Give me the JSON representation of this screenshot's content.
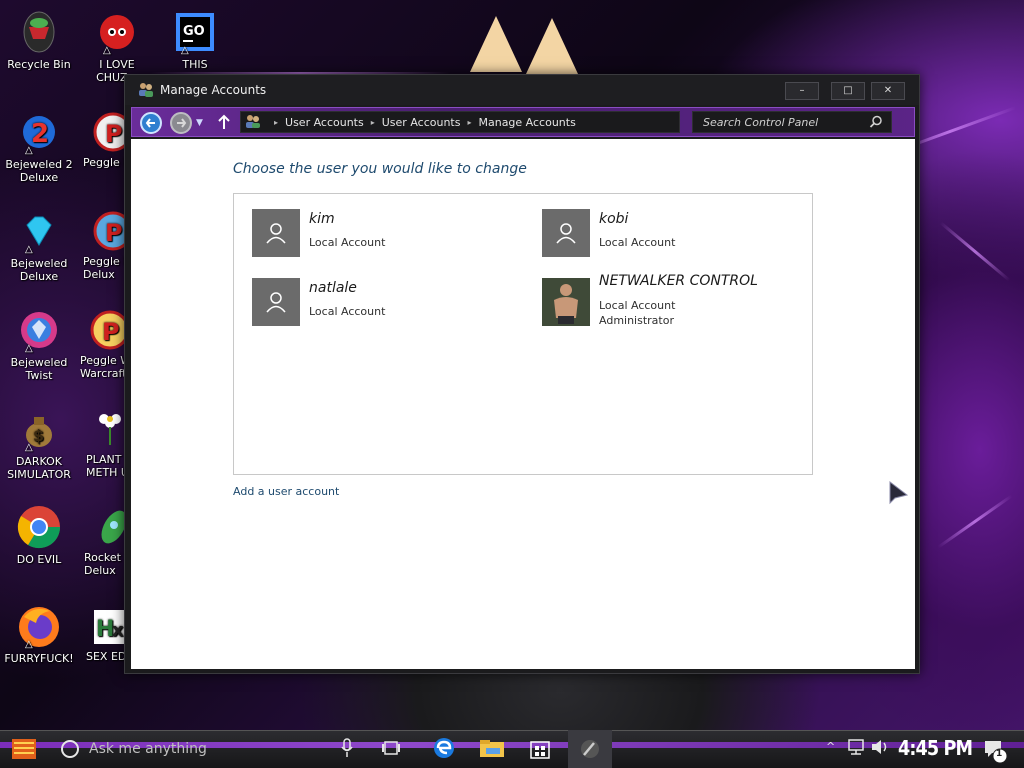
{
  "desktop": {
    "icons": [
      {
        "label1": "Recycle Bin",
        "label2": ""
      },
      {
        "label1": "Bejeweled 2",
        "label2": "Deluxe"
      },
      {
        "label1": "Bejeweled",
        "label2": "Deluxe"
      },
      {
        "label1": "Bejeweled",
        "label2": "Twist"
      },
      {
        "label1": "DARKOK",
        "label2": "SIMULATOR"
      },
      {
        "label1": "DO EVIL",
        "label2": ""
      },
      {
        "label1": "FURRYFUCK!",
        "label2": ""
      },
      {
        "label1": "I LOVE",
        "label2": "CHUZ..."
      },
      {
        "label1": "Peggle D",
        "label2": ""
      },
      {
        "label1": "Peggle N",
        "label2": "Delux"
      },
      {
        "label1": "Peggle W",
        "label2": "Warcraft"
      },
      {
        "label1": "PLANT",
        "label2": "METH U"
      },
      {
        "label1": "Rocket",
        "label2": "Delux"
      },
      {
        "label1": "SEX ED",
        "label2": ""
      },
      {
        "label1": "THIS",
        "label2": ""
      }
    ]
  },
  "window": {
    "title": "Manage Accounts",
    "minimize": "–",
    "maximize": "□",
    "close": "✕"
  },
  "address": {
    "crumbs": [
      "User Accounts",
      "User Accounts",
      "Manage Accounts"
    ],
    "search_placeholder": "Search Control Panel"
  },
  "content": {
    "heading": "Choose the user you would like to change",
    "accounts": [
      {
        "name": "kim",
        "type": "Local Account",
        "role": ""
      },
      {
        "name": "kobi",
        "type": "Local Account",
        "role": ""
      },
      {
        "name": "natlale",
        "type": "Local Account",
        "role": ""
      },
      {
        "name": "NETWALKER CONTROL",
        "type": "Local Account",
        "role": "Administrator"
      }
    ],
    "add_link": "Add a user account"
  },
  "taskbar": {
    "search_text": "Ask me anything",
    "clock": "4:45 PM",
    "notification_count": "1"
  },
  "colors": {
    "accent_purple": "#8b2fd3",
    "heading_blue": "#1e4a6e",
    "avatar_gray": "#6b6b6b"
  }
}
